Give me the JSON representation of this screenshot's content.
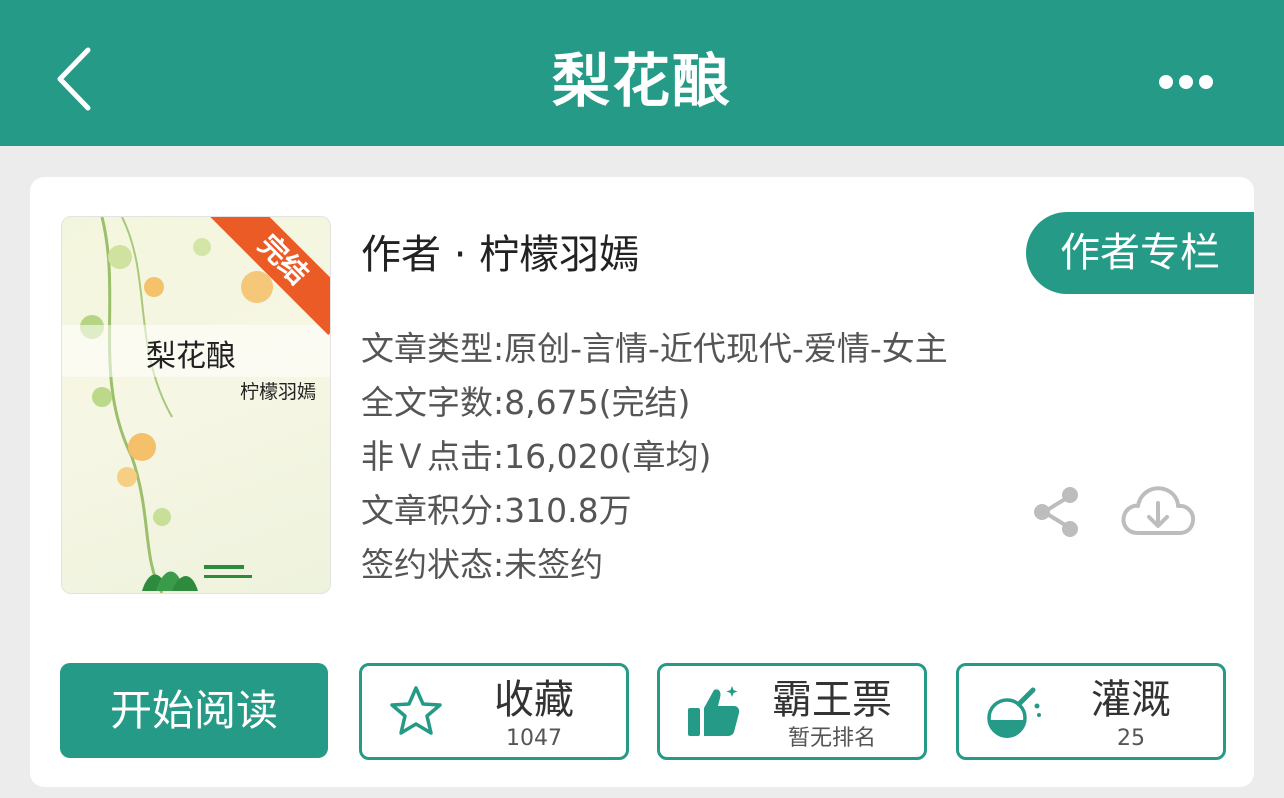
{
  "header": {
    "title": "梨花酿"
  },
  "book": {
    "cover_title": "梨花酿",
    "cover_author": "柠檬羽嫣",
    "status_ribbon": "完结",
    "author_line": "作者 · 柠檬羽嫣",
    "author_column_label": "作者专栏",
    "meta": [
      "文章类型:原创-言情-近代现代-爱情-女主",
      "全文字数:8,675(完结)",
      "非Ｖ点击:16,020(章均)",
      "文章积分:310.8万",
      "签约状态:未签约"
    ]
  },
  "actions": {
    "read_label": "开始阅读",
    "collect": {
      "label": "收藏",
      "sub": "1047"
    },
    "vote": {
      "label": "霸王票",
      "sub": "暂无排名"
    },
    "water": {
      "label": "灌溉",
      "sub": "25"
    }
  },
  "colors": {
    "accent": "#249a87",
    "ribbon": "#ea5b26"
  },
  "icons": [
    "back-arrow-icon",
    "more-dots-icon",
    "share-icon",
    "cloud-download-icon",
    "star-icon",
    "thumbs-up-icon",
    "flask-icon"
  ]
}
